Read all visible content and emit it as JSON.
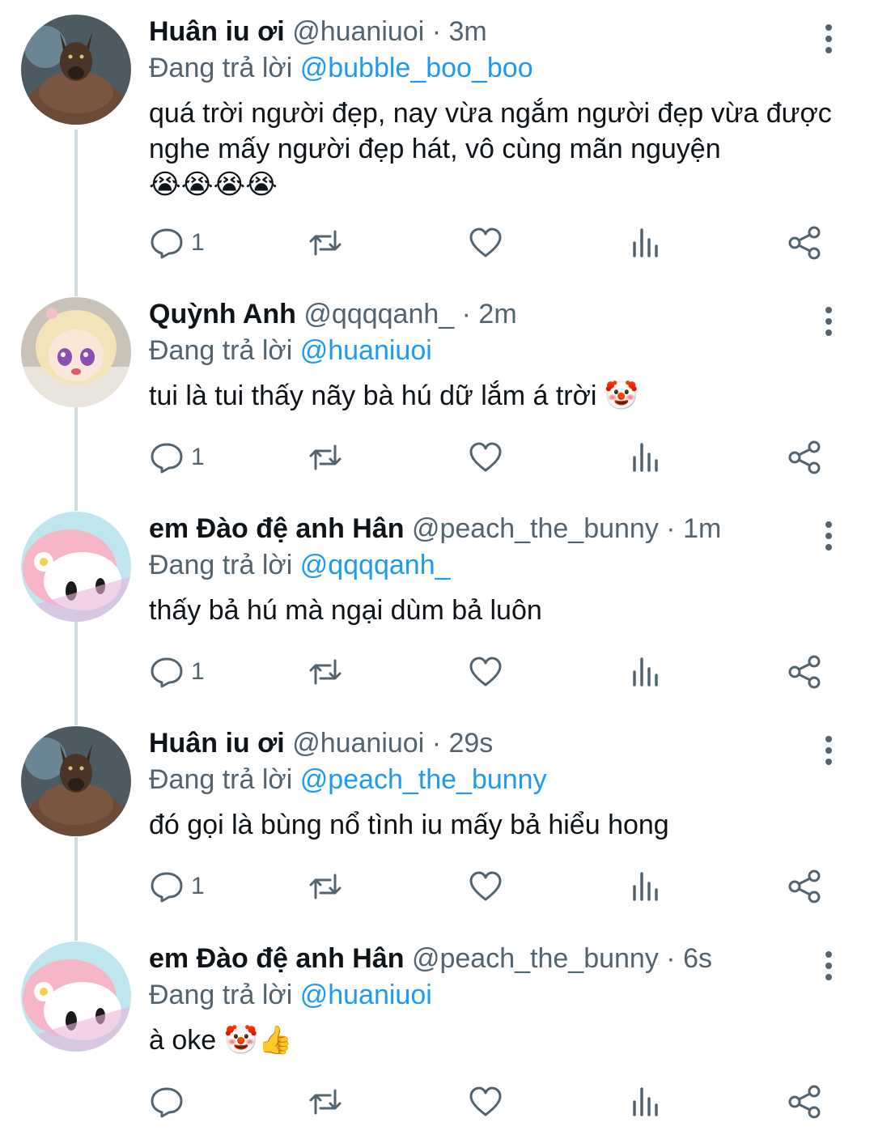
{
  "tweets": [
    {
      "name": "Huân iu ơi",
      "handle": "@huaniuoi",
      "time": "3m",
      "reply_prefix": "Đang trả lời",
      "reply_to": "@bubble_boo_boo",
      "text": "quá trời người đẹp, nay vừa ngắm người đẹp vừa được nghe mấy người đẹp hát, vô cùng mãn nguyện",
      "emoji": "😭😭😭😭",
      "reply_count": "1",
      "avatar": "wolf-avatar"
    },
    {
      "name": "Quỳnh Anh",
      "handle": "@qqqqanh_",
      "time": "2m",
      "reply_prefix": "Đang trả lời",
      "reply_to": "@huaniuoi",
      "text": "tui là tui thấy nãy bà hú dữ lắm á trời",
      "emoji": "🤡",
      "reply_count": "1",
      "avatar": "doll-avatar"
    },
    {
      "name": "em Đào đệ anh Hân",
      "handle": "@peach_the_bunny",
      "time": "1m",
      "reply_prefix": "Đang trả lời",
      "reply_to": "@qqqqanh_",
      "text": "thấy bả hú mà ngại dùm bả luôn",
      "emoji": "",
      "reply_count": "1",
      "avatar": "melody-avatar"
    },
    {
      "name": "Huân iu ơi",
      "handle": "@huaniuoi",
      "time": "29s",
      "reply_prefix": "Đang trả lời",
      "reply_to": "@peach_the_bunny",
      "text": "đó gọi là bùng nổ tình iu mấy bả hiểu hong",
      "emoji": "",
      "reply_count": "1",
      "avatar": "wolf-avatar"
    },
    {
      "name": "em Đào đệ anh Hân",
      "handle": "@peach_the_bunny",
      "time": "6s",
      "reply_prefix": "Đang trả lời",
      "reply_to": "@huaniuoi",
      "text": "à oke",
      "emoji": "🤡👍",
      "reply_count": "",
      "avatar": "melody-avatar"
    }
  ],
  "separator": " · ",
  "colors": {
    "mention": "#1d9bf0",
    "secondary": "#536471",
    "thread_line": "#cfd9de"
  }
}
